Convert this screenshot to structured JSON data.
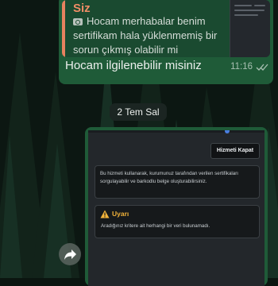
{
  "quoted_message": {
    "sender": "Siz",
    "media_icon": "camera-icon",
    "text": "Hocam merhabalar benim sertifikam hala yüklenmemiş bir sorun çıkmış olabilir mi"
  },
  "message": {
    "text": "Hocam ilgilenebilir misiniz",
    "time": "11:16",
    "status_icon": "double-check-icon"
  },
  "date_divider": "2 Tem Sal",
  "forward_icon": "forward-icon",
  "screenshot_content": {
    "close_button": "Hizmeti Kapat",
    "info_text": "Bu hizmeti kullanarak, kurumunuz tarafından verilen sertifikaları sorgulayabilir ve barkodlu belge oluşturabilirsiniz.",
    "warning_icon": "warning-icon",
    "warning_title": "Uyarı",
    "warning_text": "Aradığınız kritere ait herhangi bir veri bulunamadı."
  },
  "colors": {
    "bubble": "#1f5b38",
    "quote_accent": "#f08d66",
    "warning": "#f2b33a"
  }
}
